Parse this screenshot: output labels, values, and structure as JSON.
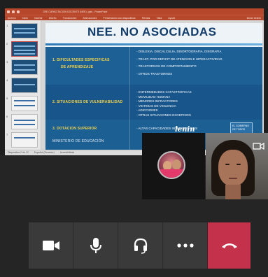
{
  "window": {
    "title_bar": "CRE CAPACITACION DOCENTE (NEE) .pptx - PowerPoint",
    "ribbon_tabs": [
      "Archivo",
      "Inicio",
      "Insertar",
      "Diseño",
      "Transiciones",
      "Animaciones",
      "Presentación con diapositivas",
      "Revisar",
      "Vista",
      "Ayuda"
    ],
    "ribbon_right": "Iniciar sesión",
    "status_items": [
      "Diapositiva 2 de 12",
      "Español (Ecuador)",
      "Accesibilidad"
    ]
  },
  "thumbnails": [
    {
      "num": "1",
      "style": "dark"
    },
    {
      "num": "2",
      "style": "dark",
      "selected": true
    },
    {
      "num": "3",
      "style": "dark"
    },
    {
      "num": "4",
      "style": "dark"
    },
    {
      "num": "5",
      "style": "light"
    },
    {
      "num": "6",
      "style": "light"
    },
    {
      "num": "7",
      "style": "light"
    }
  ],
  "slide": {
    "title": "NEE. NO ASOCIADAS",
    "rows": [
      {
        "label_lines": [
          "1.  DIFICULTADES ESPECIFICAS",
          "DE APRENDIZAJE"
        ],
        "items": [
          "- DISLEXIA, DISCALCULIA, DISORTOGRAFIA, DISGRAFIA",
          "- TRAST. POR DEFICIT DE ATENCION E HIPERACTIVIDAD",
          "- TRASTORNOS DE COMPORTAMIENTO",
          "- OTROS TRASTORNOS"
        ]
      },
      {
        "label_lines": [
          "2.  SITUACIONES DE VULNERABILIDAD"
        ],
        "items": [
          "- ENFERMEDADES CATASTROFICAS",
          "- MOVILIDAD HUMANA",
          "- MENORES INFRACTORES",
          "- VICTIMAS DE VIOLENCIA",
          "- ADICCIONES",
          "- OTRAS SITUACIONES EXCEPCION"
        ]
      },
      {
        "label_lines": [
          "3.  DOTACION SUPERIOR"
        ],
        "items": [
          "- ALTAS CAPACIDADES INTELECTUALES"
        ]
      }
    ],
    "footer_left": "MINISTERIO DE EDUCACIÓN",
    "signature": "lenin",
    "logo_text": "EL GOBIERNO DE TODOS"
  },
  "call": {
    "controls": [
      {
        "name": "camera-toggle",
        "icon": "video-camera-icon"
      },
      {
        "name": "mic-toggle",
        "icon": "microphone-icon"
      },
      {
        "name": "audio-device",
        "icon": "headset-icon"
      },
      {
        "name": "more-options",
        "icon": "more-dots-icon"
      },
      {
        "name": "end-call",
        "icon": "hang-up-icon"
      }
    ],
    "colors": {
      "end_call": "#c4314b",
      "control_bg": "#3a3a3a"
    }
  }
}
